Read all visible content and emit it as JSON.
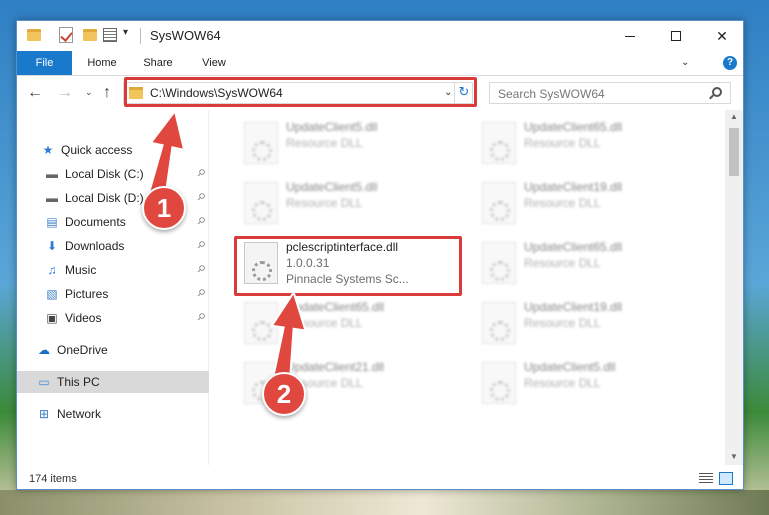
{
  "window": {
    "title": "SysWOW64",
    "minimize_symbol": "",
    "close_symbol": "✕"
  },
  "ribbon": {
    "tabs": [
      "File",
      "Home",
      "Share",
      "View"
    ],
    "help": "?"
  },
  "navbar": {
    "address": "C:\\Windows\\SysWOW64",
    "search_placeholder": "Search SysWOW64"
  },
  "sidebar": {
    "items": [
      {
        "label": "Quick access",
        "icon": "star-icon",
        "pinned": false
      },
      {
        "label": "Local Disk (C:)",
        "icon": "drive-icon",
        "pinned": true
      },
      {
        "label": "Local Disk (D:)",
        "icon": "drive-icon",
        "pinned": true
      },
      {
        "label": "Documents",
        "icon": "documents-icon",
        "pinned": true
      },
      {
        "label": "Downloads",
        "icon": "download-icon",
        "pinned": true
      },
      {
        "label": "Music",
        "icon": "music-icon",
        "pinned": true
      },
      {
        "label": "Pictures",
        "icon": "pictures-icon",
        "pinned": true
      },
      {
        "label": "Videos",
        "icon": "videos-icon",
        "pinned": true
      },
      {
        "label": "OneDrive",
        "icon": "cloud-icon",
        "pinned": false
      },
      {
        "label": "This PC",
        "icon": "computer-icon",
        "pinned": false,
        "selected": true
      },
      {
        "label": "Network",
        "icon": "network-icon",
        "pinned": false
      }
    ]
  },
  "files": [
    {
      "name": "UpdateClient5.dll",
      "line2": "Resource DLL",
      "line3": "",
      "blurred": true
    },
    {
      "name": "UpdateClient65.dll",
      "line2": "Resource DLL",
      "line3": "",
      "blurred": true
    },
    {
      "name": "UpdateClient5.dll",
      "line2": "Resource DLL",
      "line3": "",
      "blurred": true
    },
    {
      "name": "UpdateClient19.dll",
      "line2": "Resource DLL",
      "line3": "",
      "blurred": true
    },
    {
      "name": "pclescriptinterface.dll",
      "line2": "1.0.0.31",
      "line3": "Pinnacle Systems Sc...",
      "blurred": false
    },
    {
      "name": "UpdateClient65.dll",
      "line2": "Resource DLL",
      "line3": "",
      "blurred": true
    },
    {
      "name": "UpdateClient65.dll",
      "line2": "Resource DLL",
      "line3": "",
      "blurred": true
    },
    {
      "name": "UpdateClient19.dll",
      "line2": "Resource DLL",
      "line3": "",
      "blurred": true
    },
    {
      "name": "UpdateClient21.dll",
      "line2": "Resource DLL",
      "line3": "",
      "blurred": true
    },
    {
      "name": "UpdateClient5.dll",
      "line2": "Resource DLL",
      "line3": "",
      "blurred": true
    }
  ],
  "status": {
    "item_count": "174 items"
  },
  "annotations": {
    "callout_1": "1",
    "callout_2": "2",
    "color": "#e0473f"
  }
}
